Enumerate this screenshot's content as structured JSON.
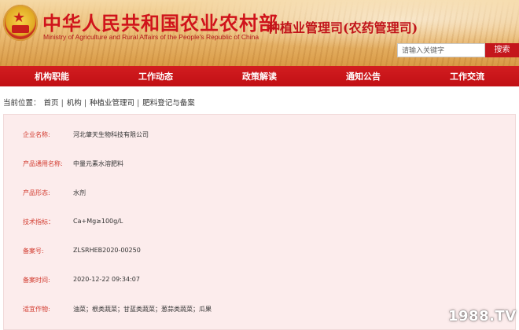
{
  "header": {
    "site_title": "中华人民共和国农业农村部",
    "site_subtitle": "Ministry of Agriculture and Rural Affairs of the People's Republic of China",
    "dept_title": "种植业管理司(农药管理司)",
    "search": {
      "placeholder": "请输入关键字",
      "button_label": "搜索"
    },
    "emblem_icon": "national-emblem-icon"
  },
  "nav": {
    "items": [
      {
        "label": "机构职能"
      },
      {
        "label": "工作动态"
      },
      {
        "label": "政策解读"
      },
      {
        "label": "通知公告"
      },
      {
        "label": "工作交流"
      }
    ]
  },
  "breadcrumb": {
    "prefix": "当前位置：",
    "items": [
      "首页",
      "机构",
      "种植业管理司",
      "肥料登记与备案"
    ],
    "separator": "|"
  },
  "record": {
    "fields": [
      {
        "label": "企业名称:",
        "value": "河北肇天生物科技有限公司"
      },
      {
        "label": "产品通用名称:",
        "value": "中量元素水溶肥料"
      },
      {
        "label": "产品形态:",
        "value": "水剂"
      },
      {
        "label": "技术指标：",
        "value": "Ca+Mg≥100g/L"
      },
      {
        "label": "备案号:",
        "value": "ZLSRHEB2020-00250"
      },
      {
        "label": "备案时间:",
        "value": "2020-12-22 09:34:07"
      },
      {
        "label": "适宜作物:",
        "value": "油菜；根类蔬菜；甘蓝类蔬菜；葱蒜类蔬菜；瓜果"
      }
    ]
  },
  "watermark": {
    "text": "1988.TV"
  },
  "colors": {
    "brand_red": "#c4161c",
    "label_red": "#d23a2e",
    "panel_bg": "#fcecec",
    "banner_gold": "#edc07a"
  }
}
